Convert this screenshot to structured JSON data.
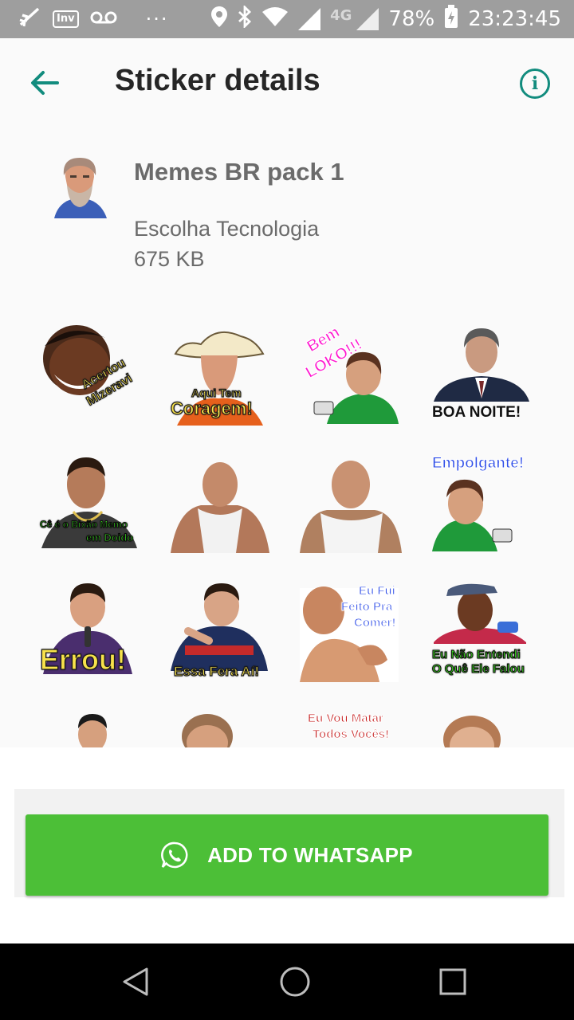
{
  "status_bar": {
    "left_icons": [
      "missed-call-icon",
      "inv-app-icon",
      "voicemail-icon",
      "more-icon"
    ],
    "inv_label": "Inv",
    "right_icons": [
      "location-icon",
      "bluetooth-icon",
      "wifi-icon",
      "signal-icon",
      "signal-4g-icon",
      "battery-icon"
    ],
    "network": "4G",
    "battery": "78%",
    "time": "23:23:45"
  },
  "app_bar": {
    "title": "Sticker details",
    "back_icon": "arrow-back-icon",
    "info_icon": "info-icon",
    "accent": "#128c7e"
  },
  "pack": {
    "name": "Memes BR pack 1",
    "publisher": "Escolha Tecnologia",
    "size": "675 KB",
    "tray_icon": "bearded-man-tray-icon"
  },
  "stickers": [
    {
      "caption_lines": [
        "Acertou",
        "Mizeravi"
      ]
    },
    {
      "caption_lines": [
        "Aqui Tem",
        "Coragem!"
      ]
    },
    {
      "caption_lines": [
        "Bem",
        "LOKO!!!"
      ]
    },
    {
      "caption_lines": [
        "BOA NOITE!"
      ]
    },
    {
      "caption_lines": [
        "Cê é o Bixão Memo",
        "em Doido"
      ]
    },
    {
      "caption_lines": []
    },
    {
      "caption_lines": []
    },
    {
      "caption_lines": [
        "Empolgante!"
      ]
    },
    {
      "caption_lines": [
        "Errou!"
      ]
    },
    {
      "caption_lines": [
        "Essa Fera Aí!"
      ]
    },
    {
      "caption_lines": [
        "Eu Fui",
        "Feito Pra",
        "Comer!"
      ]
    },
    {
      "caption_lines": [
        "Eu Não Entendi",
        "O Quê Ele Falou"
      ]
    },
    {
      "caption_lines": []
    },
    {
      "caption_lines": []
    },
    {
      "caption_lines": [
        "Eu Vou Matar",
        "Todos Vocês!"
      ]
    },
    {
      "caption_lines": []
    }
  ],
  "add_button": {
    "label": "ADD TO WHATSAPP",
    "icon": "whatsapp-icon",
    "color": "#4cbf37"
  },
  "nav_bar": {
    "icons": [
      "nav-back-icon",
      "nav-home-icon",
      "nav-recents-icon"
    ]
  }
}
